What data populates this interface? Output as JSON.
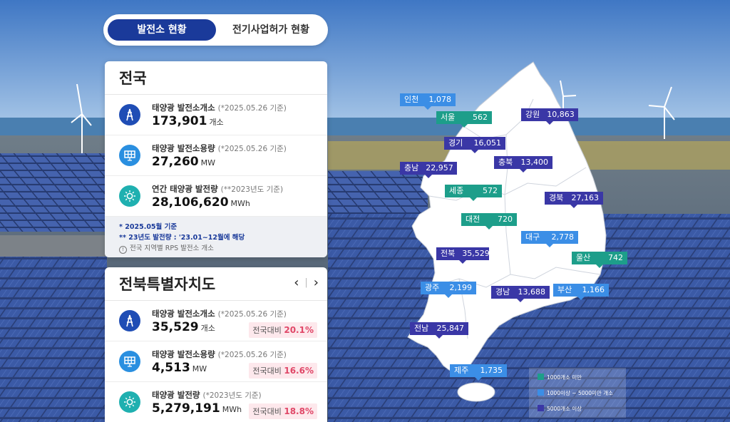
{
  "tabs": {
    "active": "발전소 현황",
    "inactive": "전기사업허가 현황"
  },
  "national": {
    "title": "전국",
    "rows": [
      {
        "icon": "pylon-icon",
        "label": "태양광 발전소개소",
        "note": "(*2025.05.26 기준)",
        "value": "173,901",
        "unit": "개소"
      },
      {
        "icon": "solar-panel-icon",
        "label": "태양광 발전소용량",
        "note": "(*2025.05.26 기준)",
        "value": "27,260",
        "unit": "MW"
      },
      {
        "icon": "sun-icon",
        "label": "연간 태양광 발전량",
        "note": "(**2023년도 기준)",
        "value": "28,106,620",
        "unit": "MWh"
      }
    ],
    "notes": {
      "n1": "* 2025.05월 기준",
      "n2": "** 23년도 발전량 : '23.01~12월에 해당",
      "n3": "전국 지역별 RPS 발전소 개소",
      "info_icon": "!"
    }
  },
  "region": {
    "title": "전북특별자치도",
    "prev": "‹",
    "next": "›",
    "separator": "|",
    "compare_label": "전국대비",
    "rows": [
      {
        "icon": "pylon-icon",
        "label": "태양광 발전소개소",
        "note": "(*2025.05.26 기준)",
        "value": "35,529",
        "unit": "개소",
        "pct": "20.1%"
      },
      {
        "icon": "solar-panel-icon",
        "label": "태양광 발전소용량",
        "note": "(*2025.05.26 기준)",
        "value": "4,513",
        "unit": "MW",
        "pct": "16.6%"
      },
      {
        "icon": "sun-icon",
        "label": "태양광 발전량",
        "note": "(*2023년도 기준)",
        "value": "5,279,191",
        "unit": "MWh",
        "pct": "18.8%"
      }
    ]
  },
  "map": {
    "regions": [
      {
        "name": "인천",
        "value": "1,078",
        "tier": "light"
      },
      {
        "name": "서울",
        "value": "562",
        "tier": "teal"
      },
      {
        "name": "강원",
        "value": "10,863",
        "tier": "dark"
      },
      {
        "name": "경기",
        "value": "16,051",
        "tier": "dark"
      },
      {
        "name": "충남",
        "value": "22,957",
        "tier": "dark"
      },
      {
        "name": "충북",
        "value": "13,400",
        "tier": "dark"
      },
      {
        "name": "세종",
        "value": "572",
        "tier": "teal"
      },
      {
        "name": "경북",
        "value": "27,163",
        "tier": "dark"
      },
      {
        "name": "대전",
        "value": "720",
        "tier": "teal"
      },
      {
        "name": "대구",
        "value": "2,778",
        "tier": "light"
      },
      {
        "name": "전북",
        "value": "35,529",
        "tier": "dark"
      },
      {
        "name": "울산",
        "value": "742",
        "tier": "teal"
      },
      {
        "name": "광주",
        "value": "2,199",
        "tier": "light"
      },
      {
        "name": "경남",
        "value": "13,688",
        "tier": "dark"
      },
      {
        "name": "부산",
        "value": "1,166",
        "tier": "light"
      },
      {
        "name": "전남",
        "value": "25,847",
        "tier": "dark"
      },
      {
        "name": "제주",
        "value": "1,735",
        "tier": "light"
      }
    ],
    "legend": [
      {
        "label": "1000개소 미만",
        "color": "#1d9e8a"
      },
      {
        "label": "1000이상 ~ 5000미만 개소",
        "color": "#3b8ee6"
      },
      {
        "label": "5000개소 이상",
        "color": "#3a37a6"
      }
    ]
  }
}
